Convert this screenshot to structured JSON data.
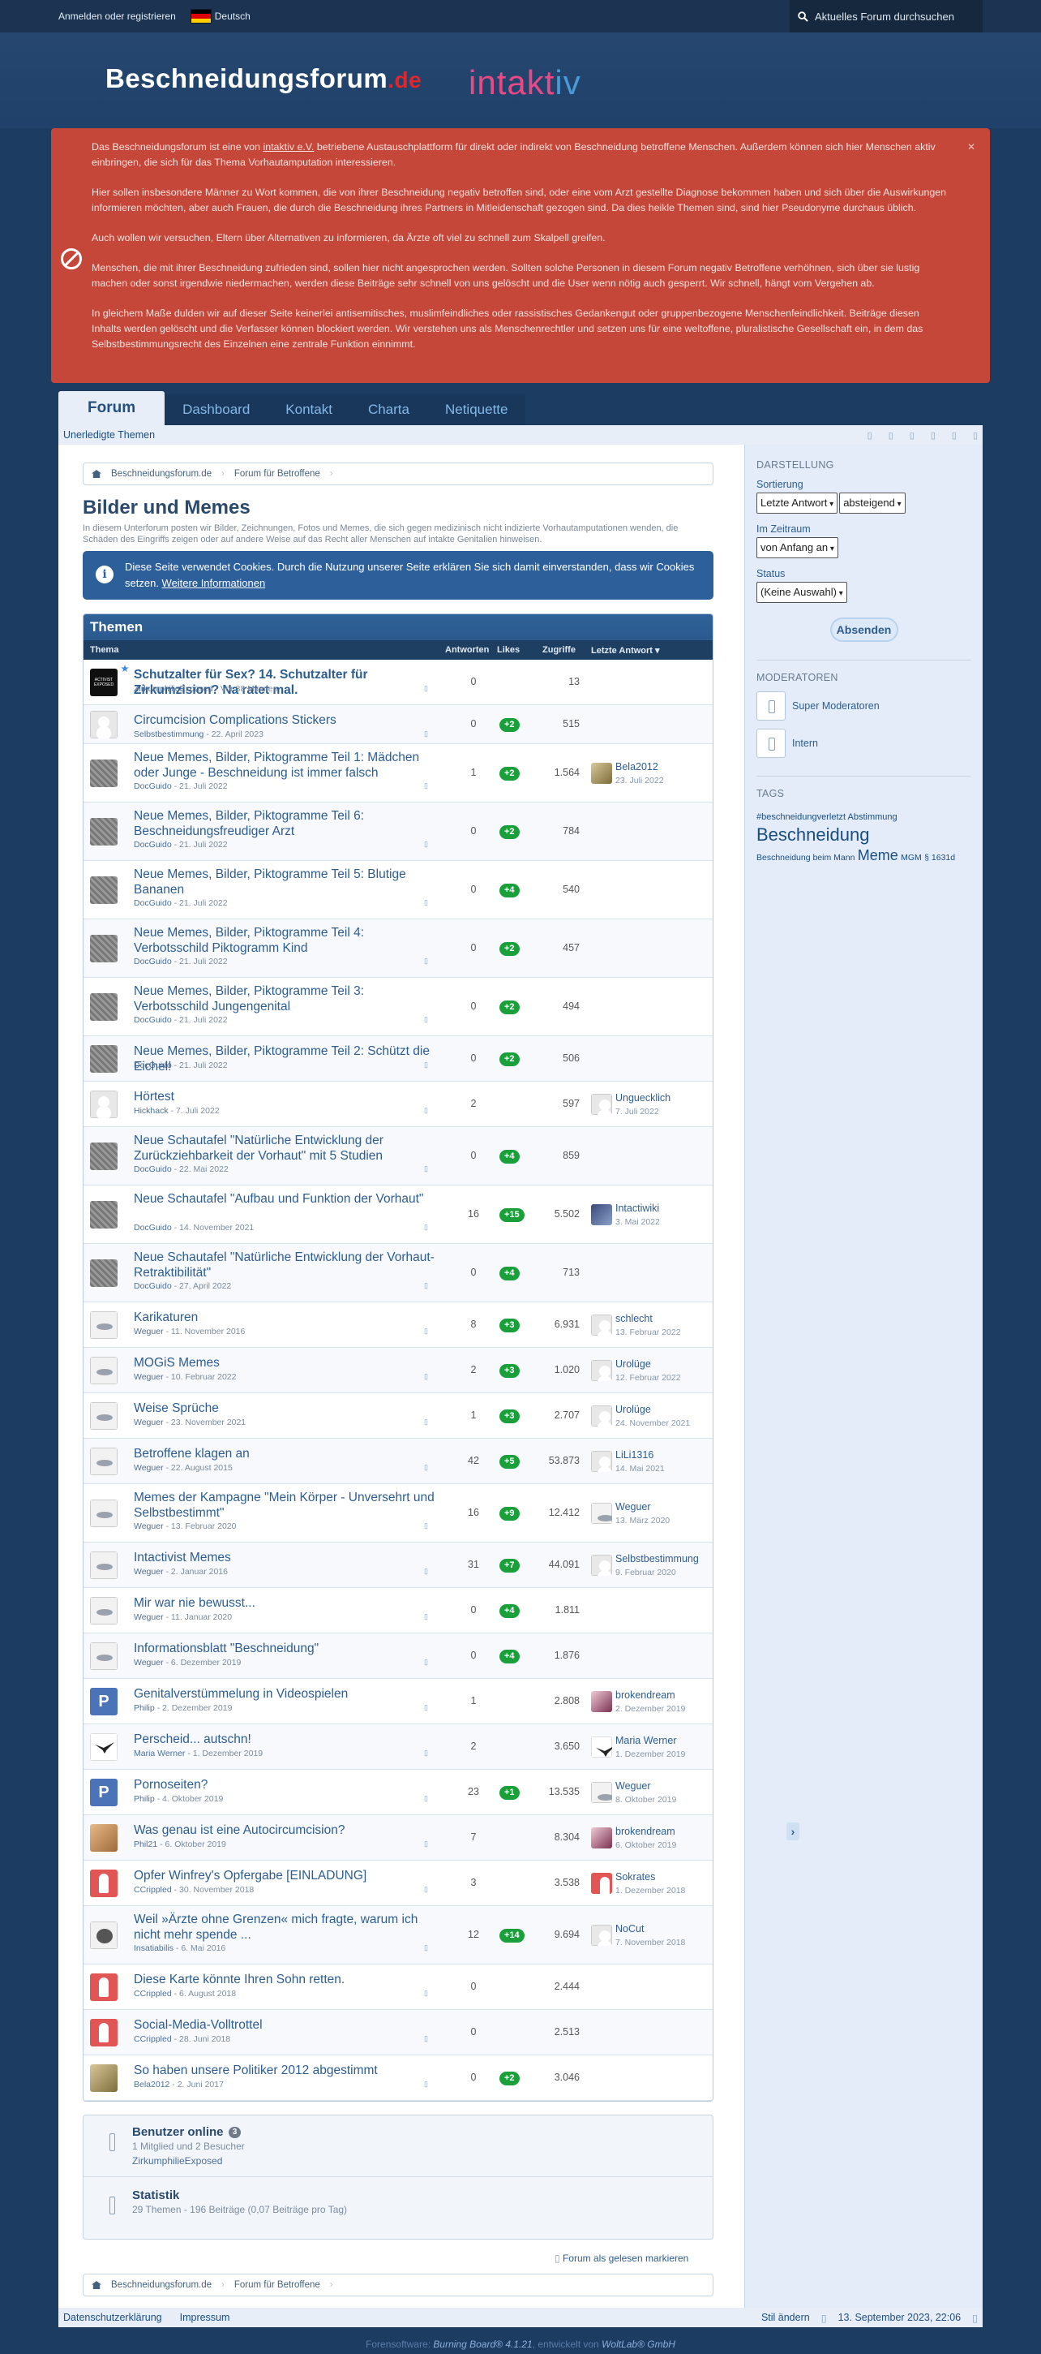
{
  "topbar": {
    "login": "Anmelden oder registrieren",
    "language": "Deutsch",
    "search_placeholder": "Aktuelles Forum durchsuchen"
  },
  "logo": {
    "main": "Beschneidungsforum",
    "tld": ".de",
    "second_i": "i",
    "second_ntakt": "ntakt",
    "second_iv": "iv"
  },
  "notice": {
    "p1a": "Das Beschneidungsforum ist eine von ",
    "p1link": "intaktiv e.V.",
    "p1b": " betriebene Austauschplattform für direkt oder indirekt von Beschneidung betroffene Menschen. Außerdem können sich hier Menschen aktiv einbringen, die sich für das Thema Vorhautamputation interessieren.",
    "p2": "Hier sollen insbesondere Männer zu Wort kommen, die von ihrer Beschneidung negativ betroffen sind, oder eine vom Arzt gestellte Diagnose bekommen haben und sich über die Auswirkungen informieren möchten, aber auch Frauen, die durch die Beschneidung ihres Partners in Mitleidenschaft gezogen sind. Da dies heikle Themen sind, sind hier Pseudonyme durchaus üblich.",
    "p3": "Auch wollen wir versuchen, Eltern über Alternativen zu informieren, da Ärzte oft viel zu schnell zum Skalpell greifen.",
    "p4": "Menschen, die mit ihrer Beschneidung zufrieden sind, sollen hier nicht angesprochen werden. Sollten solche Personen in diesem Forum negativ Betroffene verhöhnen, sich über sie lustig machen oder sonst irgendwie niedermachen, werden diese Beiträge sehr schnell von uns gelöscht und die User wenn nötig auch gesperrt. Wir schnell, hängt vom Vergehen ab.",
    "p5": "In gleichem Maße dulden wir auf dieser Seite keinerlei antisemitisches, muslimfeindliches oder rassistisches Gedankengut oder gruppenbezogene Menschenfeindlichkeit. Beiträge diesen Inhalts werden gelöscht und die Verfasser können blockiert werden. Wir verstehen uns als Menschenrechtler und setzen uns für eine weltoffene, pluralistische Gesellschaft ein, in dem das Selbstbestimmungsrecht des Einzelnen eine zentrale Funktion einnimmt."
  },
  "nav": {
    "tabs": [
      "Forum",
      "Dashboard",
      "Kontakt",
      "Charta",
      "Netiquette"
    ],
    "sub": "Unerledigte Themen"
  },
  "breadcrumb": [
    "Beschneidungsforum.de",
    "Forum für Betroffene"
  ],
  "page": {
    "title": "Bilder und Memes",
    "description": "In diesem Unterforum posten wir Bilder, Zeichnungen, Fotos und Memes, die sich gegen medizinisch nicht indizierte Vorhautamputationen wenden, die Schäden des Eingriffs zeigen oder auf andere Weise auf das Recht aller Menschen auf intakte Genitalien hinweisen."
  },
  "cookie": {
    "text": "Diese Seite verwendet Cookies. Durch die Nutzung unserer Seite erklären Sie sich damit einverstanden, dass wir Cookies setzen. ",
    "link": "Weitere Informationen"
  },
  "table": {
    "heading": "Themen",
    "cols": {
      "topic": "Thema",
      "answers": "Antworten",
      "likes": "Likes",
      "views": "Zugriffe",
      "last": "Letzte Antwort ▾"
    },
    "rows": [
      {
        "title": "Schutzalter für Sex? 14. Schutzalter für Zirkumzision? Na ratet mal.",
        "author": "ZirkumphilieExposed",
        "date": "Vor 38 Minuten",
        "answers": "0",
        "likes": "",
        "views": "13",
        "last_user": "",
        "last_date": "",
        "thumb": "blackbox",
        "bold": true,
        "star": true
      },
      {
        "title": "Circumcision Complications Stickers",
        "author": "Selbstbestimmung",
        "date": "22. April 2023",
        "answers": "0",
        "likes": "+2",
        "views": "515",
        "last_user": "",
        "last_date": "",
        "thumb": "blank"
      },
      {
        "title": "Neue Memes, Bilder, Piktogramme Teil 1: Mädchen oder Junge - Beschneidung ist immer falsch",
        "author": "DocGuido",
        "date": "21. Juli 2022",
        "answers": "1",
        "likes": "+2",
        "views": "1.564",
        "last_user": "Bela2012",
        "last_date": "23. Juli 2022",
        "thumb": "gray",
        "lthumb": "bela"
      },
      {
        "title": "Neue Memes, Bilder, Piktogramme Teil 6: Beschneidungsfreudiger Arzt",
        "author": "DocGuido",
        "date": "21. Juli 2022",
        "answers": "0",
        "likes": "+2",
        "views": "784",
        "last_user": "",
        "last_date": "",
        "thumb": "gray"
      },
      {
        "title": "Neue Memes, Bilder, Piktogramme Teil 5: Blutige Bananen",
        "author": "DocGuido",
        "date": "21. Juli 2022",
        "answers": "0",
        "likes": "+4",
        "views": "540",
        "last_user": "",
        "last_date": "",
        "thumb": "gray"
      },
      {
        "title": "Neue Memes, Bilder, Piktogramme Teil 4: Verbotsschild Piktogramm Kind",
        "author": "DocGuido",
        "date": "21. Juli 2022",
        "answers": "0",
        "likes": "+2",
        "views": "457",
        "last_user": "",
        "last_date": "",
        "thumb": "gray"
      },
      {
        "title": "Neue Memes, Bilder, Piktogramme Teil 3: Verbotsschild Jungengenital",
        "author": "DocGuido",
        "date": "21. Juli 2022",
        "answers": "0",
        "likes": "+2",
        "views": "494",
        "last_user": "",
        "last_date": "",
        "thumb": "gray"
      },
      {
        "title": "Neue Memes, Bilder, Piktogramme Teil 2: Schützt die Eichel!",
        "author": "DocGuido",
        "date": "21. Juli 2022",
        "answers": "0",
        "likes": "+2",
        "views": "506",
        "last_user": "",
        "last_date": "",
        "thumb": "gray"
      },
      {
        "title": "Hörtest",
        "author": "Hickhack",
        "date": "7. Juli 2022",
        "answers": "2",
        "likes": "",
        "views": "597",
        "last_user": "Unguecklich",
        "last_date": "7. Juli 2022",
        "thumb": "blank",
        "lthumb": "blank"
      },
      {
        "title": "Neue Schautafel \"Natürliche Entwicklung der Zurückziehbarkeit der Vorhaut\" mit 5 Studien",
        "author": "DocGuido",
        "date": "22. Mai 2022",
        "answers": "0",
        "likes": "+4",
        "views": "859",
        "last_user": "",
        "last_date": "",
        "thumb": "gray"
      },
      {
        "title": "Neue Schautafel \"Aufbau und Funktion der Vorhaut\"",
        "author": "DocGuido",
        "date": "14. November 2021",
        "answers": "16",
        "likes": "+15",
        "views": "5.502",
        "last_user": "Intactiwiki",
        "last_date": "3. Mai 2022",
        "thumb": "gray",
        "lthumb": "dark"
      },
      {
        "title": "Neue Schautafel \"Natürliche Entwicklung der Vorhaut-Retraktibilität\"",
        "author": "DocGuido",
        "date": "27. April 2022",
        "answers": "0",
        "likes": "+4",
        "views": "713",
        "last_user": "",
        "last_date": "",
        "thumb": "gray"
      },
      {
        "title": "Karikaturen",
        "author": "Weguer",
        "date": "11. November 2016",
        "answers": "8",
        "likes": "+3",
        "views": "6.931",
        "last_user": "schlecht",
        "last_date": "13. Februar 2022",
        "thumb": "weguer",
        "lthumb": "blank"
      },
      {
        "title": "MOGiS Memes",
        "author": "Weguer",
        "date": "10. Februar 2022",
        "answers": "2",
        "likes": "+3",
        "views": "1.020",
        "last_user": "Urolüge",
        "last_date": "12. Februar 2022",
        "thumb": "weguer",
        "lthumb": "blank"
      },
      {
        "title": "Weise Sprüche",
        "author": "Weguer",
        "date": "23. November 2021",
        "answers": "1",
        "likes": "+3",
        "views": "2.707",
        "last_user": "Urolüge",
        "last_date": "24. November 2021",
        "thumb": "weguer",
        "lthumb": "blank"
      },
      {
        "title": "Betroffene klagen an",
        "author": "Weguer",
        "date": "22. August 2015",
        "answers": "42",
        "likes": "+5",
        "views": "53.873",
        "last_user": "LiLi1316",
        "last_date": "14. Mai 2021",
        "thumb": "weguer",
        "lthumb": "blank"
      },
      {
        "title": "Memes der Kampagne \"Mein Körper - Unversehrt und Selbstbestimmt\"",
        "author": "Weguer",
        "date": "13. Februar 2020",
        "answers": "16",
        "likes": "+9",
        "views": "12.412",
        "last_user": "Weguer",
        "last_date": "13. März 2020",
        "thumb": "weguer",
        "lthumb": "weguer"
      },
      {
        "title": "Intactivist Memes",
        "author": "Weguer",
        "date": "2. Januar 2016",
        "answers": "31",
        "likes": "+7",
        "views": "44.091",
        "last_user": "Selbstbestimmung",
        "last_date": "9. Februar 2020",
        "thumb": "weguer",
        "lthumb": "blank"
      },
      {
        "title": "Mir war nie bewusst...",
        "author": "Weguer",
        "date": "11. Januar 2020",
        "answers": "0",
        "likes": "+4",
        "views": "1.811",
        "last_user": "",
        "last_date": "",
        "thumb": "weguer"
      },
      {
        "title": "Informationsblatt \"Beschneidung\"",
        "author": "Weguer",
        "date": "6. Dezember 2019",
        "answers": "0",
        "likes": "+4",
        "views": "1.876",
        "last_user": "",
        "last_date": "",
        "thumb": "weguer"
      },
      {
        "title": "Genitalverstümmelung in Videospielen",
        "author": "Philip",
        "date": "2. Dezember 2019",
        "answers": "1",
        "likes": "",
        "views": "2.808",
        "last_user": "brokendream",
        "last_date": "2. Dezember 2019",
        "thumb": "P",
        "lthumb": "pink"
      },
      {
        "title": "Perscheid... autschn!",
        "author": "Maria Werner",
        "date": "1. Dezember 2019",
        "answers": "2",
        "likes": "",
        "views": "3.650",
        "last_user": "Maria Werner",
        "last_date": "1. Dezember 2019",
        "thumb": "bird",
        "lthumb": "bird"
      },
      {
        "title": "Pornoseiten?",
        "author": "Philip",
        "date": "4. Oktober 2019",
        "answers": "23",
        "likes": "+1",
        "views": "13.535",
        "last_user": "Weguer",
        "last_date": "8. Oktober 2019",
        "thumb": "P",
        "lthumb": "weguer"
      },
      {
        "title": "Was genau ist eine Autocircumcision?",
        "author": "Phil21",
        "date": "6. Oktober 2019",
        "answers": "7",
        "likes": "",
        "views": "8.304",
        "last_user": "brokendream",
        "last_date": "6. Oktober 2019",
        "thumb": "photo",
        "lthumb": "pink"
      },
      {
        "title": "Opfer Winfrey's Opfergabe [EINLADUNG]",
        "author": "CCrippled",
        "date": "30. November 2018",
        "answers": "3",
        "likes": "",
        "views": "3.538",
        "last_user": "Sokrates",
        "last_date": "1. Dezember 2018",
        "thumb": "red",
        "lthumb": "red"
      },
      {
        "title": "Weil »Ärzte ohne Grenzen« mich fragte, warum ich nicht mehr spende ...",
        "author": "Insatiabilis",
        "date": "6. Mai 2016",
        "answers": "12",
        "likes": "+14",
        "views": "9.694",
        "last_user": "NoCut",
        "last_date": "7. November 2018",
        "thumb": "msf",
        "lthumb": "blank"
      },
      {
        "title": "Diese Karte könnte Ihren Sohn retten.",
        "author": "CCrippled",
        "date": "6. August 2018",
        "answers": "0",
        "likes": "",
        "views": "2.444",
        "last_user": "",
        "last_date": "",
        "thumb": "red"
      },
      {
        "title": "Social-Media-Volltrottel",
        "author": "CCrippled",
        "date": "28. Juni 2018",
        "answers": "0",
        "likes": "",
        "views": "2.513",
        "last_user": "",
        "last_date": "",
        "thumb": "red"
      },
      {
        "title": "So haben unsere Politiker 2012 abgestimmt",
        "author": "Bela2012",
        "date": "2. Juni 2017",
        "answers": "0",
        "likes": "+2",
        "views": "3.046",
        "last_user": "",
        "last_date": "",
        "thumb": "bela"
      }
    ]
  },
  "online": {
    "title": "Benutzer online",
    "count": "3",
    "sub": "1 Mitglied und 2 Besucher",
    "user": "ZirkumphilieExposed",
    "stats_title": "Statistik",
    "stats": "29 Themen - 196 Beiträge (0,07 Beiträge pro Tag)"
  },
  "markread": "Forum als gelesen markieren",
  "sidebar": {
    "display": "DARSTELLUNG",
    "sort_label": "Sortierung",
    "sort_value": "Letzte Antwort",
    "order_value": "absteigend",
    "period_label": "Im Zeitraum",
    "period_value": "von Anfang an",
    "status_label": "Status",
    "status_value": "(Keine Auswahl)",
    "submit": "Absenden",
    "mods": "MODERATOREN",
    "mod1": "Super Moderatoren",
    "mod2": "Intern",
    "tags": "TAGS",
    "tag1": "#beschneidungverletzt Abstimmung",
    "tag2": "Beschneidung",
    "tag3": "Beschneidung beim Mann",
    "tag4": "Meme",
    "tag5": "MGM",
    "tag6": "§ 1631d"
  },
  "footer": {
    "privacy": "Datenschutzerklärung",
    "imprint": "Impressum",
    "style": "Stil ändern",
    "time": "13. September 2023, 22:06",
    "credit_a": "Forensoftware: ",
    "credit_b": "Burning Board® 4.1.21",
    "credit_c": ", entwickelt von ",
    "credit_d": "WoltLab® GmbH"
  }
}
